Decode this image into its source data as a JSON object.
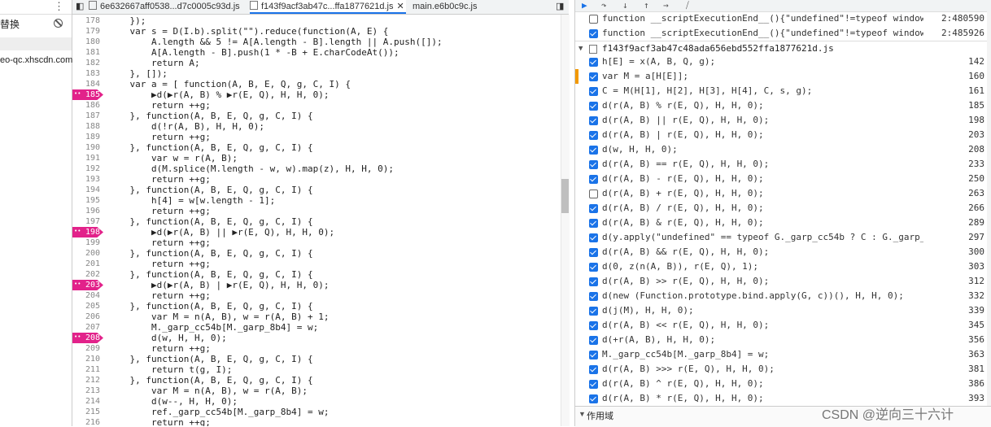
{
  "left_panel": {
    "replace_label": "替换",
    "host": "eo-qc.xhscdn.com"
  },
  "tabs": [
    {
      "label": "6e632667aff0538...d7c0005c93d.js"
    },
    {
      "label": "f143f9acf3ab47c...ffa1877621d.js"
    },
    {
      "label": "main.e6b0c9c.js"
    }
  ],
  "editor": {
    "lines": [
      {
        "n": "178",
        "text": "    });"
      },
      {
        "n": "179",
        "text": "    var s = D(I.b).split(\"\").reduce(function(A, E) {"
      },
      {
        "n": "180",
        "text": "        A.length && 5 != A[A.length - B].length || A.push([]);"
      },
      {
        "n": "181",
        "text": "        A[A.length - B].push(1 * -B + E.charCodeAt());"
      },
      {
        "n": "182",
        "text": "        return A;"
      },
      {
        "n": "183",
        "text": "    }, []);"
      },
      {
        "n": "184",
        "text": "    var a = [ function(A, B, E, Q, g, C, I) {"
      },
      {
        "n": "185",
        "text": "        ▶d(▶r(A, B) % ▶r(E, Q), H, H, 0);",
        "bp": true
      },
      {
        "n": "186",
        "text": "        return ++g;"
      },
      {
        "n": "187",
        "text": "    }, function(A, B, E, Q, g, C, I) {"
      },
      {
        "n": "188",
        "text": "        d(!r(A, B), H, H, 0);"
      },
      {
        "n": "189",
        "text": "        return ++g;"
      },
      {
        "n": "190",
        "text": "    }, function(A, B, E, Q, g, C, I) {"
      },
      {
        "n": "191",
        "text": "        var w = r(A, B);"
      },
      {
        "n": "192",
        "text": "        d(M.splice(M.length - w, w).map(z), H, H, 0);"
      },
      {
        "n": "193",
        "text": "        return ++g;"
      },
      {
        "n": "194",
        "text": "    }, function(A, B, E, Q, g, C, I) {"
      },
      {
        "n": "195",
        "text": "        h[4] = w[w.length - 1];"
      },
      {
        "n": "196",
        "text": "        return ++g;"
      },
      {
        "n": "197",
        "text": "    }, function(A, B, E, Q, g, C, I) {"
      },
      {
        "n": "198",
        "text": "        ▶d(▶r(A, B) || ▶r(E, Q), H, H, 0);",
        "bp": true
      },
      {
        "n": "199",
        "text": "        return ++g;"
      },
      {
        "n": "200",
        "text": "    }, function(A, B, E, Q, g, C, I) {"
      },
      {
        "n": "201",
        "text": "        return ++g;"
      },
      {
        "n": "202",
        "text": "    }, function(A, B, E, Q, g, C, I) {"
      },
      {
        "n": "203",
        "text": "        ▶d(▶r(A, B) | ▶r(E, Q), H, H, 0);",
        "bp": true
      },
      {
        "n": "204",
        "text": "        return ++g;"
      },
      {
        "n": "205",
        "text": "    }, function(A, B, E, Q, g, C, I) {"
      },
      {
        "n": "206",
        "text": "        var M = n(A, B), w = r(A, B) + 1;"
      },
      {
        "n": "207",
        "text": "        M._garp_cc54b[M._garp_8b4] = w;"
      },
      {
        "n": "208",
        "text": "        d(w, H, H, 0);",
        "bp": true
      },
      {
        "n": "209",
        "text": "        return ++g;"
      },
      {
        "n": "210",
        "text": "    }, function(A, B, E, Q, g, C, I) {"
      },
      {
        "n": "211",
        "text": "        return t(g, I);"
      },
      {
        "n": "212",
        "text": "    }, function(A, B, E, Q, g, C, I) {"
      },
      {
        "n": "213",
        "text": "        var M = n(A, B), w = r(A, B);"
      },
      {
        "n": "214",
        "text": "        d(w--, H, H, 0);"
      },
      {
        "n": "215",
        "text": "        ref._garp_cc54b[M._garp_8b4] = w;"
      },
      {
        "n": "216",
        "text": "        return ++g;"
      },
      {
        "n": "217",
        "text": "    }, function(A, B, E, Q, g, C, I) {"
      }
    ]
  },
  "breakpoints": {
    "top_rows": [
      {
        "text": "function __scriptExecutionEnd__(){\"undefined\"!=typeof window&&window...",
        "line": "2:480590",
        "checked": false
      },
      {
        "text": "function __scriptExecutionEnd__(){\"undefined\"!=typeof window&&window...",
        "line": "2:485926",
        "checked": true
      }
    ],
    "file": "f143f9acf3ab47c48ada656ebd552ffa1877621d.js",
    "rows": [
      {
        "text": "h[E] = x(A, B, Q, g);",
        "line": "142",
        "checked": true
      },
      {
        "text": "var M = a[H[E]];",
        "line": "160",
        "checked": true,
        "paused": true
      },
      {
        "text": "C = M(H[1], H[2], H[3], H[4], C, s, g);",
        "line": "161",
        "checked": true
      },
      {
        "text": "d(r(A, B) % r(E, Q), H, H, 0);",
        "line": "185",
        "checked": true
      },
      {
        "text": "d(r(A, B) || r(E, Q), H, H, 0);",
        "line": "198",
        "checked": true
      },
      {
        "text": "d(r(A, B) | r(E, Q), H, H, 0);",
        "line": "203",
        "checked": true
      },
      {
        "text": "d(w, H, H, 0);",
        "line": "208",
        "checked": true
      },
      {
        "text": "d(r(A, B) == r(E, Q), H, H, 0);",
        "line": "233",
        "checked": true
      },
      {
        "text": "d(r(A, B) - r(E, Q), H, H, 0);",
        "line": "250",
        "checked": true
      },
      {
        "text": "d(r(A, B) + r(E, Q), H, H, 0);",
        "line": "263",
        "checked": false
      },
      {
        "text": "d(r(A, B) / r(E, Q), H, H, 0);",
        "line": "266",
        "checked": true
      },
      {
        "text": "d(r(A, B) & r(E, Q), H, H, 0);",
        "line": "289",
        "checked": true
      },
      {
        "text": "d(y.apply(\"undefined\" == typeof G._garp_cc54b ? C : G._garp_cc54b, Y), H,...",
        "line": "297",
        "checked": true
      },
      {
        "text": "d(r(A, B) && r(E, Q), H, H, 0);",
        "line": "300",
        "checked": true
      },
      {
        "text": "d(0, z(n(A, B)), r(E, Q), 1);",
        "line": "303",
        "checked": true
      },
      {
        "text": "d(r(A, B) >> r(E, Q), H, H, 0);",
        "line": "312",
        "checked": true
      },
      {
        "text": "d(new (Function.prototype.bind.apply(G, c))(), H, H, 0);",
        "line": "332",
        "checked": true
      },
      {
        "text": "d(j(M), H, H, 0);",
        "line": "339",
        "checked": true
      },
      {
        "text": "d(r(A, B) << r(E, Q), H, H, 0);",
        "line": "345",
        "checked": true
      },
      {
        "text": "d(+r(A, B), H, H, 0);",
        "line": "356",
        "checked": true
      },
      {
        "text": "M._garp_cc54b[M._garp_8b4] = w;",
        "line": "363",
        "checked": true
      },
      {
        "text": "d(r(A, B) >>> r(E, Q), H, H, 0);",
        "line": "381",
        "checked": true
      },
      {
        "text": "d(r(A, B) ^ r(E, Q), H, H, 0);",
        "line": "386",
        "checked": true
      },
      {
        "text": "d(r(A, B) * r(E, Q), H, H, 0);",
        "line": "393",
        "checked": true
      }
    ],
    "scope_label": "作用域"
  },
  "watermark": "CSDN @逆向三十六计",
  "colors": {
    "breakpoint": "#e2228a",
    "checkbox": "#1a73e8",
    "paused": "#f29900"
  }
}
